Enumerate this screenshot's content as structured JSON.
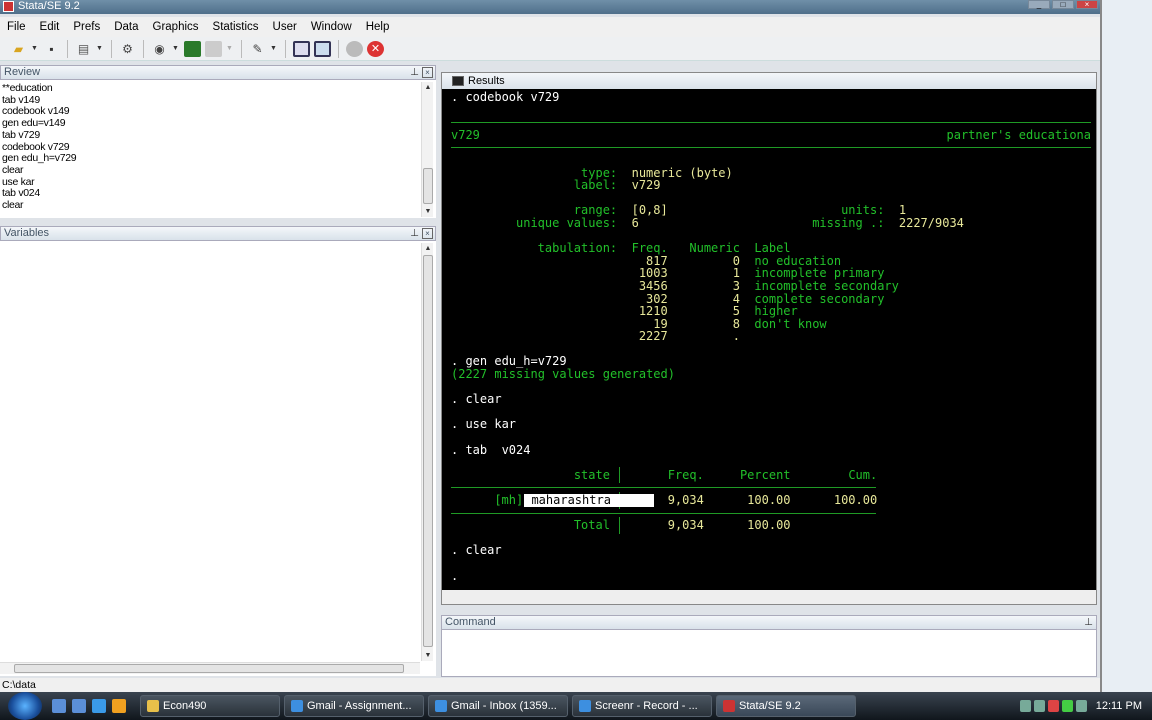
{
  "window": {
    "title": "Stata/SE 9.2"
  },
  "menu": [
    "File",
    "Edit",
    "Prefs",
    "Data",
    "Graphics",
    "Statistics",
    "User",
    "Window",
    "Help"
  ],
  "review": {
    "title": "Review",
    "items": [
      "**education",
      "tab  v149",
      "codebook v149",
      "gen edu=v149",
      "tab  v729",
      "codebook v729",
      "gen edu_h=v729",
      "clear",
      "use kar",
      "tab  v024",
      "clear"
    ]
  },
  "variables": {
    "title": "Variables"
  },
  "results": {
    "title": "Results",
    "cmd1": ". codebook v729",
    "varname": "v729",
    "varlabel": "partner's educationa",
    "type_k": "type:",
    "type_v": "numeric (byte)",
    "label_k": "label:",
    "label_v": "v729",
    "range_k": "range:",
    "range_v": "[0,8]",
    "units_k": "units:",
    "units_v": "1",
    "unique_k": "unique values:",
    "unique_v": "6",
    "missing_k": "missing .:",
    "missing_v": "2227/9034",
    "tab_k": "tabulation:",
    "tab_h": [
      "Freq.",
      "Numeric",
      "Label"
    ],
    "tab_rows": [
      {
        "freq": "817",
        "num": "0",
        "label": "no education"
      },
      {
        "freq": "1003",
        "num": "1",
        "label": "incomplete primary"
      },
      {
        "freq": "3456",
        "num": "3",
        "label": "incomplete secondary"
      },
      {
        "freq": "302",
        "num": "4",
        "label": "complete secondary"
      },
      {
        "freq": "1210",
        "num": "5",
        "label": "higher"
      },
      {
        "freq": "19",
        "num": "8",
        "label": "don't know"
      },
      {
        "freq": "2227",
        "num": ".",
        "label": ""
      }
    ],
    "cmd2": ". gen edu_h=v729",
    "msg2": "(2227 missing values generated)",
    "cmd3": ". clear",
    "cmd4": ". use kar",
    "cmd5": ". tab  v024",
    "t2_h": [
      "state",
      "Freq.",
      "Percent",
      "Cum."
    ],
    "t2_row": {
      "code": "[mh]",
      "state": "maharashtra",
      "freq": "9,034",
      "pct": "100.00",
      "cum": "100.00"
    },
    "t2_total": {
      "label": "Total",
      "freq": "9,034",
      "pct": "100.00"
    },
    "cmd6": ". clear",
    "prompt": "."
  },
  "command": {
    "title": "Command",
    "value": ""
  },
  "status": {
    "path": "C:\\data"
  },
  "taskbar": {
    "items": [
      "Econ490",
      "Gmail - Assignment...",
      "Gmail - Inbox (1359...",
      "Screenr - Record - ...",
      "Stata/SE 9.2"
    ],
    "clock": "12:11 PM"
  }
}
